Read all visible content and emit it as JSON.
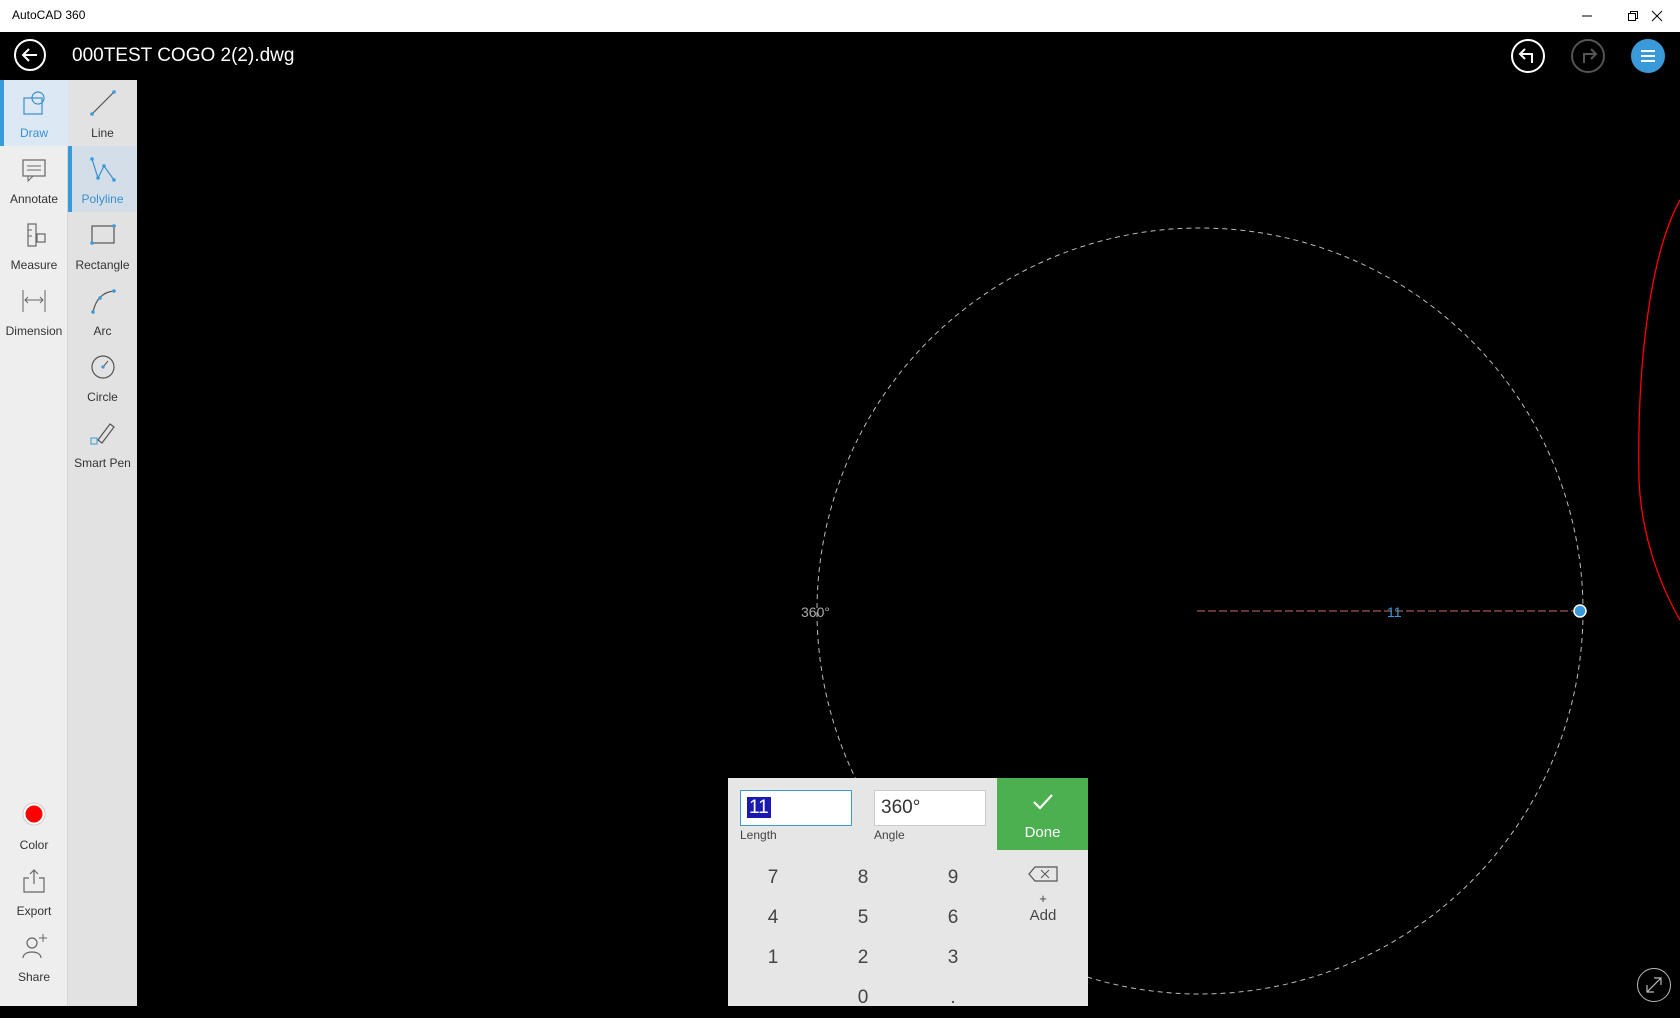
{
  "window": {
    "title": "AutoCAD 360",
    "controls": [
      "minimize",
      "restore",
      "close"
    ]
  },
  "appbar": {
    "document_title": "000TEST COGO 2(2).dwg",
    "buttons": [
      "back-icon",
      "undo-icon",
      "redo-icon",
      "menu-icon"
    ]
  },
  "categories": [
    {
      "label": "Draw",
      "icon": "draw-icon",
      "active": true
    },
    {
      "label": "Annotate",
      "icon": "annotate-icon",
      "active": false
    },
    {
      "label": "Measure",
      "icon": "measure-icon",
      "active": false
    },
    {
      "label": "Dimension",
      "icon": "dimension-icon",
      "active": false
    }
  ],
  "bottom_items": [
    {
      "label": "Color",
      "icon": "color-swatch-icon",
      "color": "#ff0000"
    },
    {
      "label": "Export",
      "icon": "export-icon"
    },
    {
      "label": "Share",
      "icon": "share-icon"
    }
  ],
  "tools": [
    {
      "label": "Line",
      "icon": "line-icon",
      "active": false
    },
    {
      "label": "Polyline",
      "icon": "polyline-icon",
      "active": true
    },
    {
      "label": "Rectangle",
      "icon": "rectangle-icon",
      "active": false
    },
    {
      "label": "Arc",
      "icon": "arc-icon",
      "active": false
    },
    {
      "label": "Circle",
      "icon": "circle-icon",
      "active": false
    },
    {
      "label": "Smart Pen",
      "icon": "smart-pen-icon",
      "active": false
    }
  ],
  "canvas": {
    "angle_label": "360°",
    "length_label": "11"
  },
  "keypad": {
    "length_value": "11",
    "length_label": "Length",
    "angle_value": "360°",
    "angle_label": "Angle",
    "done_label": "Done",
    "keys": [
      "7",
      "8",
      "9",
      "4",
      "5",
      "6",
      "1",
      "2",
      "3",
      "0",
      "."
    ],
    "add_symbol": "+",
    "add_label": "Add"
  },
  "colors": {
    "accent": "#3a9ad9",
    "done": "#4caf50",
    "entity_red": "#ff0000"
  }
}
